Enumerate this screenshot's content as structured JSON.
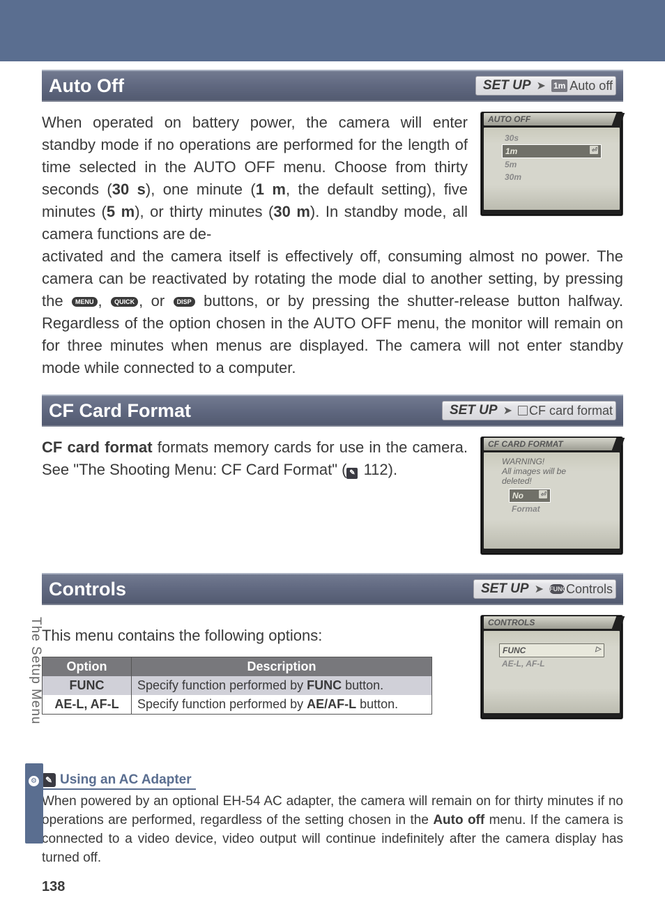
{
  "page_number": "138",
  "side_label": "The Setup Menu",
  "sections": {
    "auto_off": {
      "title": "Auto Off",
      "breadcrumb": {
        "setup": "SET UP",
        "icon": "1m",
        "label": "Auto off"
      },
      "para1": "When operated on battery power, the camera will enter standby mode if no operations are performed for the length of time selected in the AUTO OFF menu. Choose from thirty seconds (",
      "p1b1": "30 s",
      "p1m1": "), one minute (",
      "p1b2": "1 m",
      "p1m2": ", the default setting), five minutes (",
      "p1b3": "5 m",
      "p1m3": "), or thirty minutes (",
      "p1b4": "30 m",
      "p1m4": ").  In standby mode, all camera functions are de-",
      "para2a": "activated and the camera itself is effectively off, consuming almost no power. The camera can be reactivated by rotating the mode dial to another setting, by pressing the ",
      "badge1": "MENU",
      "badge2": "QUICK",
      "badge3": "DISP",
      "para2b": " buttons, or by pressing the shutter-release button halfway.  Regardless of the option chosen in the AUTO OFF menu, the monitor will remain on for three minutes when menus are displayed.  The camera will not enter standby mode while connected to a computer.",
      "lcd": {
        "title": "AUTO OFF",
        "options": [
          "30s",
          "1m",
          "5m",
          "30m"
        ],
        "selected_index": 1
      }
    },
    "cf": {
      "title": "CF Card Format",
      "breadcrumb": {
        "setup": "SET UP",
        "icon": "",
        "label": "CF card format"
      },
      "para_pre_bold": "CF card format",
      "para_rest": " formats memory cards for use in the camera.  See \"The Shooting Menu: CF Card Format\" (",
      "page_ref": " 112).",
      "lcd": {
        "title": "CF CARD FORMAT",
        "warn1": "WARNING!",
        "warn2": "All images will be",
        "warn3": "deleted!",
        "options": [
          "No",
          "Format"
        ],
        "selected_index": 0
      }
    },
    "controls": {
      "title": "Controls",
      "breadcrumb": {
        "setup": "SET UP",
        "icon": "FUNC",
        "label": "Controls"
      },
      "intro": "This menu contains the following options:",
      "table": {
        "headers": [
          "Option",
          "Description"
        ],
        "rows": [
          {
            "opt": "FUNC",
            "desc_a": "Specify function performed by ",
            "desc_b": "FUNC",
            "desc_c": " button."
          },
          {
            "opt": "AE-L, AF-L",
            "desc_a": "Specify function performed by ",
            "desc_b": "AE/AF-L",
            "desc_c": " button."
          }
        ]
      },
      "lcd": {
        "title": "CONTROLS",
        "options": [
          "FUNC",
          "AE-L, AF-L"
        ],
        "selected_index": 0
      }
    }
  },
  "note": {
    "title": "Using an AC Adapter",
    "body_a": "When powered by an optional EH-54 AC adapter, the camera will remain on for thirty minutes if no operations are performed, regardless of the setting chosen in the ",
    "body_bold": "Auto off",
    "body_b": " menu.  If the camera is connected to a video device, video output will continue indefinitely after the camera display has turned off."
  }
}
